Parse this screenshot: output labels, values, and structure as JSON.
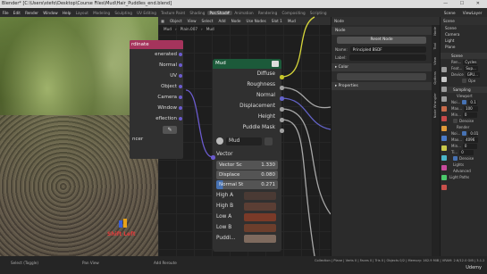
{
  "window": {
    "title": "Blender* [C:\\Users\\stefo\\Desktop\\Course Files\\Mud\\Hair_Puddles_end.blend]",
    "controls": "— ☐ ✕"
  },
  "menubar": {
    "menus": [
      "File",
      "Edit",
      "Render",
      "Window",
      "Help"
    ],
    "workspaces": [
      "Layout",
      "Modeling",
      "Sculpting",
      "UV Editing",
      "Texture Paint",
      "Shading",
      "Animation",
      "Rendering",
      "Compositing",
      "Scripting"
    ],
    "selected_workspace_label": "Pos:Shad#",
    "scene": "Scene",
    "view_layer": "ViewLayer"
  },
  "node_editor": {
    "header": [
      "Object",
      "View",
      "Select",
      "Add",
      "Node",
      "Use Nodes",
      "Slot 1",
      "Mud"
    ],
    "breadcrumb": [
      "Mud",
      "Plain.007",
      "Mud"
    ],
    "left_node": {
      "title": "rdinate",
      "rows": [
        "enerated",
        "Normal",
        "UV",
        "Object",
        "Camera",
        "Window",
        "eflection"
      ],
      "object_icon": "eyedropper-icon",
      "footer": "ncer"
    },
    "mud_node": {
      "title": "Mud",
      "outputs": [
        "Diffuse",
        "Roughness",
        "Normal",
        "Displacement",
        "Height",
        "Puddle Mask"
      ],
      "group_name": "Mud",
      "inputs": {
        "vector": "Vector",
        "vector_scale_label": "Vector Sc",
        "vector_scale_value": "1.330",
        "displace_label": "Displace",
        "displace_value": "0.080",
        "normal_strength_label": "Normal St",
        "normal_strength_value": "0.271"
      },
      "colors": [
        {
          "label": "High A",
          "hex": "#4a3a34"
        },
        {
          "label": "High B",
          "hex": "#5b3e34"
        },
        {
          "label": "Low A",
          "hex": "#7a3a28"
        },
        {
          "label": "Low B",
          "hex": "#6c3e2c"
        },
        {
          "label": "Puddl...",
          "hex": "#7e6a5e"
        }
      ]
    }
  },
  "properties": {
    "tabs": [
      "Node",
      "Tool",
      "View",
      "Options"
    ],
    "node_section": "Node",
    "reset_button": "Reset Node",
    "name_label": "Name:",
    "name_value": "Principled BSDF",
    "label_label": "Label:",
    "label_value": "",
    "color_section": "Color",
    "properties_section": "Properties"
  },
  "vertical_tabs": [
    "Node",
    "Tool",
    "View",
    "Options",
    "Node Wrangler"
  ],
  "outliner": {
    "header": "Scene",
    "items": [
      "Scene",
      "Camera",
      "Light",
      "Plane"
    ],
    "scene_section": "Scene",
    "render_engine_label": "Ren...",
    "render_engine_value": "Cycles",
    "feature_label": "Feat...",
    "feature_value": "Sup...",
    "device_label": "Device",
    "device_value": "GPU...",
    "open_label": "Ope",
    "sampling_section": "Sampling",
    "viewport_section": "Viewport",
    "noise_threshold_label": "Noi...",
    "noise_threshold_value": "0.1",
    "max_label": "Max...",
    "max_value": "100",
    "min_label": "Min...",
    "min_value": "0",
    "denoise_label": "Denoise",
    "render_section": "Render",
    "noise2_label": "Noi...",
    "noise2_value": "0.01",
    "max2_label": "Max...",
    "max2_value": "4096",
    "min2_label": "Min...",
    "min2_value": "0",
    "time_label": "Ti...",
    "time_value": "0",
    "denoise2_label": "Denoise",
    "lights_section": "Lights",
    "advanced_section": "Advanced",
    "light_paths": "Light Paths"
  },
  "viewport": {
    "overlay_text": "Shift Left"
  },
  "statusbar": {
    "left": "Select (Toggle)",
    "middle": "Pan View",
    "middle2": "Add Reroute",
    "stats": "Collection | Plane | Verts 0 | Faces 0 | Tris 0 | Objects 0/2 | Memory: 162.9 MiB | VRAM: 2.6/12.0 GiB | 3.1.2",
    "brand": "Udemy"
  }
}
